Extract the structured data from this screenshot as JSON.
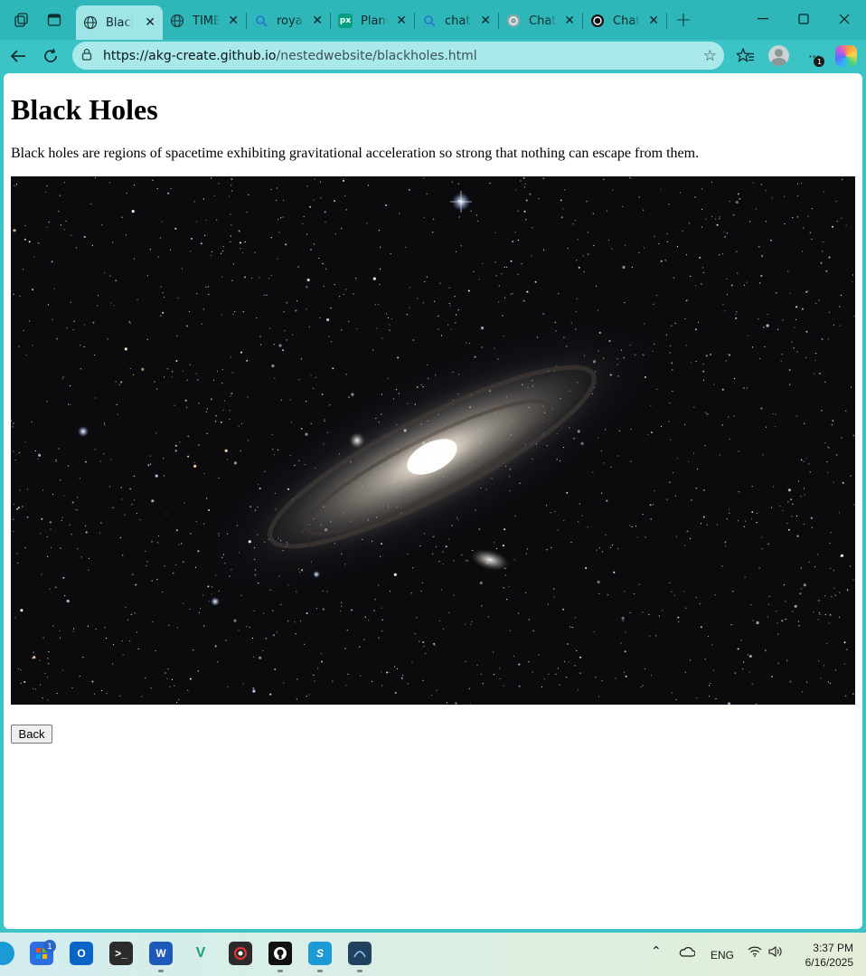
{
  "browser": {
    "tabs": [
      {
        "title": "Black",
        "favicon": "globe-icon",
        "active": true
      },
      {
        "title": "TIME F",
        "favicon": "globe-icon",
        "active": false
      },
      {
        "title": "royalt",
        "favicon": "search-icon",
        "active": false
      },
      {
        "title": "Planet",
        "favicon": "pexels-icon",
        "active": false
      },
      {
        "title": "chatgp",
        "favicon": "search-icon",
        "active": false
      },
      {
        "title": "ChatG",
        "favicon": "openai-icon",
        "active": false
      },
      {
        "title": "ChatG",
        "favicon": "openai-icon",
        "active": false
      }
    ],
    "address": {
      "host": "https://akg-create.github.io",
      "path": "/nestedwebsite/blackholes.html"
    },
    "notification_count": "1"
  },
  "page": {
    "heading": "Black Holes",
    "description": "Black holes are regions of spacetime exhibiting gravitational acceleration so strong that nothing can escape from them.",
    "back_button": "Back"
  },
  "taskbar": {
    "store_badge": "1",
    "language": "ENG",
    "time": "3:37 PM",
    "date": "6/16/2025"
  },
  "colors": {
    "tabbar": "#2fb6b9",
    "active_tab": "#9fe4e6",
    "omnibox": "#a9e9ea"
  }
}
